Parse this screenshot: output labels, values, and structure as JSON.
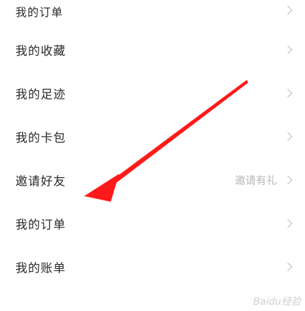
{
  "menu": {
    "items": [
      {
        "label": "我的订单",
        "hint": ""
      },
      {
        "label": "我的收藏",
        "hint": ""
      },
      {
        "label": "我的足迹",
        "hint": ""
      },
      {
        "label": "我的卡包",
        "hint": ""
      },
      {
        "label": "邀请好友",
        "hint": "邀请有礼"
      },
      {
        "label": "我的订单",
        "hint": ""
      },
      {
        "label": "我的账单",
        "hint": ""
      }
    ]
  },
  "annotation": {
    "arrow_color": "#ff1a1a"
  },
  "watermark": {
    "text": "Baidu经验"
  }
}
